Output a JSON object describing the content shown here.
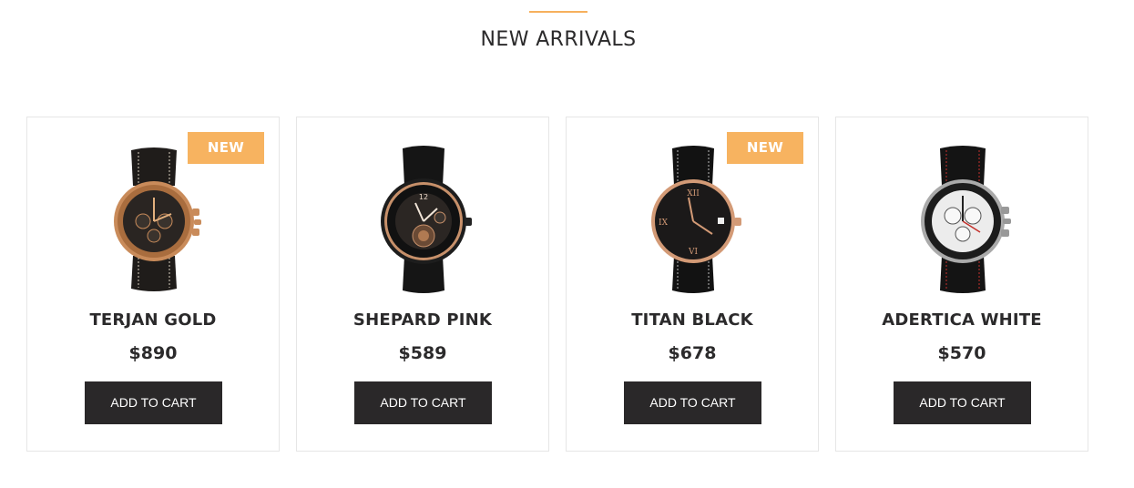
{
  "section": {
    "title": "NEW ARRIVALS",
    "accent": "#f6b05d"
  },
  "products": [
    {
      "name": "TERJAN GOLD",
      "price": "$890",
      "badge": "NEW",
      "cta": "ADD TO CART",
      "image": "gold-chronograph-watch-icon"
    },
    {
      "name": "SHEPARD PINK",
      "price": "$589",
      "badge": "",
      "cta": "ADD TO CART",
      "image": "black-skeleton-watch-icon"
    },
    {
      "name": "TITAN BLACK",
      "price": "$678",
      "badge": "NEW",
      "cta": "ADD TO CART",
      "image": "rose-gold-dress-watch-icon"
    },
    {
      "name": "ADERTICA WHITE",
      "price": "$570",
      "badge": "",
      "cta": "ADD TO CART",
      "image": "silver-chronograph-watch-icon"
    }
  ],
  "colors": {
    "badge": "#f7b360",
    "button": "#2a2829",
    "text": "#2b2a2b",
    "border": "#e6e6e6"
  }
}
